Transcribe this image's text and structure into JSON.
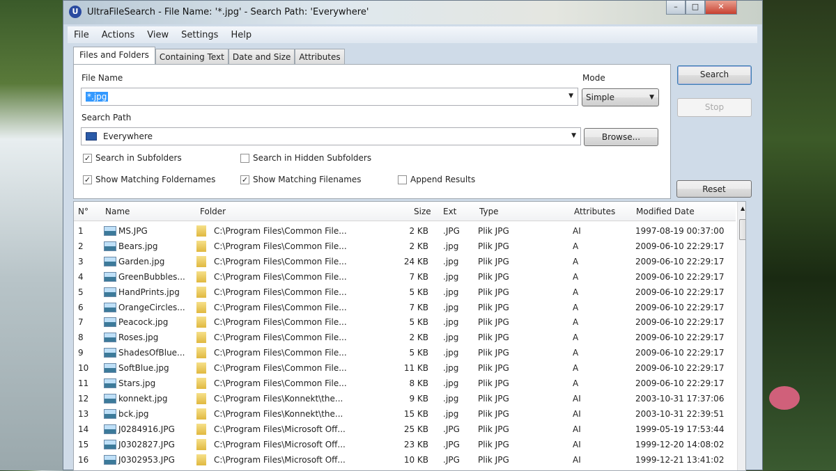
{
  "window": {
    "title": "UltraFileSearch - File Name: '*.jpg' - Search Path: 'Everywhere'",
    "controls": [
      "–",
      "□",
      "✕"
    ]
  },
  "menu": [
    "File",
    "Actions",
    "View",
    "Settings",
    "Help"
  ],
  "tabs": [
    "Files and Folders",
    "Containing Text",
    "Date and Size",
    "Attributes"
  ],
  "form": {
    "file_name_label": "File Name",
    "file_name_value": "*.jpg",
    "mode_label": "Mode",
    "mode_value": "Simple",
    "search_path_label": "Search Path",
    "search_path_value": "Everywhere",
    "browse": "Browse...",
    "checkboxes": [
      {
        "label": "Search in Subfolders",
        "checked": true
      },
      {
        "label": "Search in Hidden Subfolders",
        "checked": false
      },
      {
        "label": "Show Matching Foldernames",
        "checked": true
      },
      {
        "label": "Show Matching Filenames",
        "checked": true
      },
      {
        "label": "Append Results",
        "checked": false
      }
    ]
  },
  "buttons": {
    "search": "Search",
    "stop": "Stop",
    "reset": "Reset"
  },
  "columns": [
    "N°",
    "Name",
    "Folder",
    "Size",
    "Ext",
    "Type",
    "Attributes",
    "Modified Date"
  ],
  "rows": [
    [
      "1",
      "MS.JPG",
      "C:\\Program Files\\Common File...",
      "2 KB",
      ".JPG",
      "Plik JPG",
      "AI",
      "1997-08-19 00:37:00"
    ],
    [
      "2",
      "Bears.jpg",
      "C:\\Program Files\\Common File...",
      "2 KB",
      ".jpg",
      "Plik JPG",
      "A",
      "2009-06-10 22:29:17"
    ],
    [
      "3",
      "Garden.jpg",
      "C:\\Program Files\\Common File...",
      "24 KB",
      ".jpg",
      "Plik JPG",
      "A",
      "2009-06-10 22:29:17"
    ],
    [
      "4",
      "GreenBubbles...",
      "C:\\Program Files\\Common File...",
      "7 KB",
      ".jpg",
      "Plik JPG",
      "A",
      "2009-06-10 22:29:17"
    ],
    [
      "5",
      "HandPrints.jpg",
      "C:\\Program Files\\Common File...",
      "5 KB",
      ".jpg",
      "Plik JPG",
      "A",
      "2009-06-10 22:29:17"
    ],
    [
      "6",
      "OrangeCircles...",
      "C:\\Program Files\\Common File...",
      "7 KB",
      ".jpg",
      "Plik JPG",
      "A",
      "2009-06-10 22:29:17"
    ],
    [
      "7",
      "Peacock.jpg",
      "C:\\Program Files\\Common File...",
      "5 KB",
      ".jpg",
      "Plik JPG",
      "A",
      "2009-06-10 22:29:17"
    ],
    [
      "8",
      "Roses.jpg",
      "C:\\Program Files\\Common File...",
      "2 KB",
      ".jpg",
      "Plik JPG",
      "A",
      "2009-06-10 22:29:17"
    ],
    [
      "9",
      "ShadesOfBlue...",
      "C:\\Program Files\\Common File...",
      "5 KB",
      ".jpg",
      "Plik JPG",
      "A",
      "2009-06-10 22:29:17"
    ],
    [
      "10",
      "SoftBlue.jpg",
      "C:\\Program Files\\Common File...",
      "11 KB",
      ".jpg",
      "Plik JPG",
      "A",
      "2009-06-10 22:29:17"
    ],
    [
      "11",
      "Stars.jpg",
      "C:\\Program Files\\Common File...",
      "8 KB",
      ".jpg",
      "Plik JPG",
      "A",
      "2009-06-10 22:29:17"
    ],
    [
      "12",
      "konnekt.jpg",
      "C:\\Program Files\\Konnekt\\the...",
      "9 KB",
      ".jpg",
      "Plik JPG",
      "AI",
      "2003-10-31 17:37:06"
    ],
    [
      "13",
      "bck.jpg",
      "C:\\Program Files\\Konnekt\\the...",
      "15 KB",
      ".jpg",
      "Plik JPG",
      "AI",
      "2003-10-31 22:39:51"
    ],
    [
      "14",
      "J0284916.JPG",
      "C:\\Program Files\\Microsoft Off...",
      "25 KB",
      ".JPG",
      "Plik JPG",
      "AI",
      "1999-05-19 17:53:44"
    ],
    [
      "15",
      "J0302827.JPG",
      "C:\\Program Files\\Microsoft Off...",
      "23 KB",
      ".JPG",
      "Plik JPG",
      "AI",
      "1999-12-20 14:08:02"
    ],
    [
      "16",
      "J0302953.JPG",
      "C:\\Program Files\\Microsoft Off...",
      "10 KB",
      ".JPG",
      "Plik JPG",
      "AI",
      "1999-12-21 13:41:02"
    ]
  ]
}
